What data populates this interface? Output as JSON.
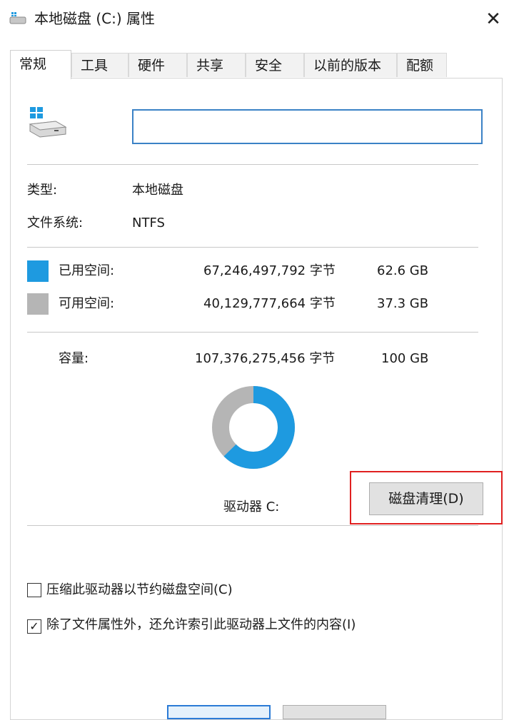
{
  "window": {
    "title": "本地磁盘 (C:) 属性",
    "close_glyph": "✕",
    "icon": "drive-icon"
  },
  "tabs": [
    {
      "label": "常规",
      "active": true
    },
    {
      "label": "工具",
      "active": false
    },
    {
      "label": "硬件",
      "active": false
    },
    {
      "label": "共享",
      "active": false
    },
    {
      "label": "安全",
      "active": false
    },
    {
      "label": "以前的版本",
      "active": false
    },
    {
      "label": "配额",
      "active": false
    }
  ],
  "general": {
    "drive_icon": "windows-drive-icon",
    "name_value": "",
    "type_label": "类型:",
    "type_value": "本地磁盘",
    "fs_label": "文件系统:",
    "fs_value": "NTFS",
    "used": {
      "label": "已用空间:",
      "bytes": "67,246,497,792 字节",
      "size": "62.6 GB",
      "color": "#1e9ae0"
    },
    "free": {
      "label": "可用空间:",
      "bytes": "40,129,777,664 字节",
      "size": "37.3 GB",
      "color": "#b5b5b5"
    },
    "capacity": {
      "label": "容量:",
      "bytes": "107,376,275,456 字节",
      "size": "100 GB"
    },
    "usage_fraction": 0.626,
    "drive_label": "驱动器 C:",
    "cleanup_button": "磁盘清理(D)",
    "highlight_color": "#e02020"
  },
  "options": {
    "compress": {
      "label": "压缩此驱动器以节约磁盘空间(C)",
      "checked": false
    },
    "index": {
      "label": "除了文件属性外，还允许索引此驱动器上文件的内容(I)",
      "checked": true
    },
    "check_glyph": "✓"
  }
}
